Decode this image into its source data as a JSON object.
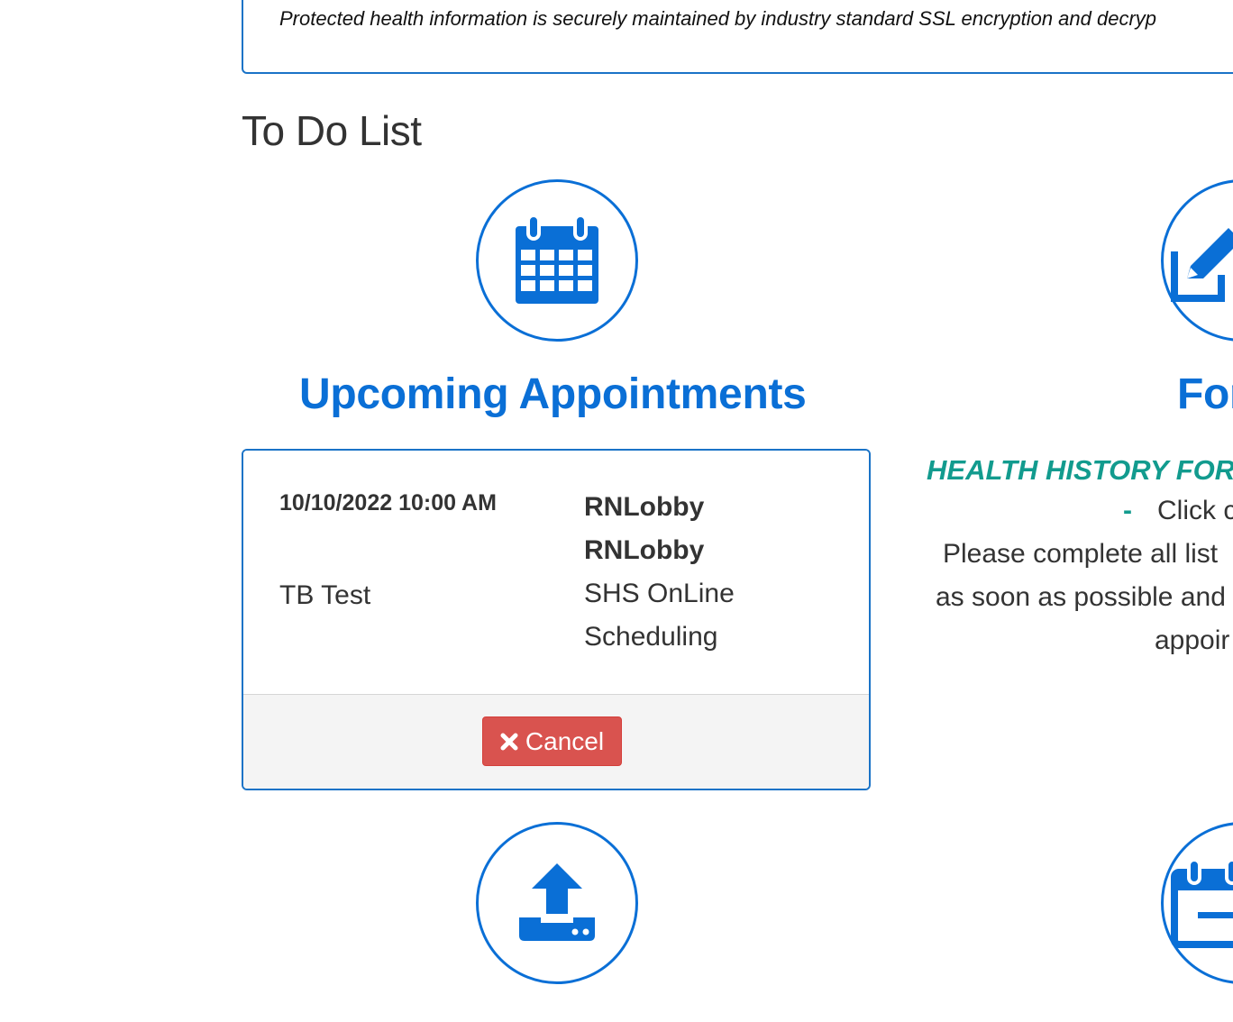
{
  "notice": {
    "text": "Protected health information is securely maintained by industry standard SSL encryption and decryp"
  },
  "todo": {
    "title": "To Do List"
  },
  "appointments": {
    "title": "Upcoming Appointments",
    "icon": "calendar-icon",
    "items": [
      {
        "datetime": "10/10/2022 10:00 AM",
        "location_primary": "RNLobby",
        "location_secondary": "RNLobby",
        "type": "TB Test",
        "channel_line1": "SHS OnLine",
        "channel_line2": "Scheduling"
      }
    ],
    "cancel_label": "Cancel"
  },
  "forms": {
    "title": "For",
    "icon": "pencil-square-icon",
    "subtitle": "HEALTH HISTORY FOR",
    "dash": "-",
    "line1": "Click c",
    "line2": "Please complete all list",
    "line3": "as soon as possible and",
    "line4": "appoir"
  },
  "upload": {
    "icon": "upload-icon"
  },
  "schedule": {
    "icon": "calendar-minus-icon"
  },
  "colors": {
    "primary": "#0a6fd6",
    "border": "#1a73c7",
    "danger": "#d9534f",
    "teal": "#129b8e",
    "text": "#333333"
  }
}
